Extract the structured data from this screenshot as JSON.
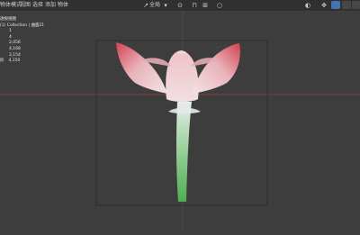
{
  "header": {
    "mode_label": "物体模式",
    "menus": [
      "视图",
      "选择",
      "添加",
      "物体"
    ],
    "transform_label": "全局"
  },
  "overlay": {
    "view_name": "透视视图",
    "collection": "(1) Collection | 曲面21",
    "stats": [
      {
        "label": "",
        "value": "1"
      },
      {
        "label": "",
        "value": "4"
      },
      {
        "label": "",
        "value": "2,056"
      },
      {
        "label": "",
        "value": "4,168"
      },
      {
        "label": "",
        "value": "2,154"
      },
      {
        "label": "形",
        "value": "4,150"
      }
    ]
  },
  "colors": {
    "viewport_bg": "#3d3d3d",
    "grid": "#4a4a4a",
    "x_axis": "#8c3a3a",
    "y_axis": "#6a8a2a",
    "petal_tip": "#d94a58",
    "petal_base": "#f2dde0",
    "stem": "#5fb85f"
  }
}
